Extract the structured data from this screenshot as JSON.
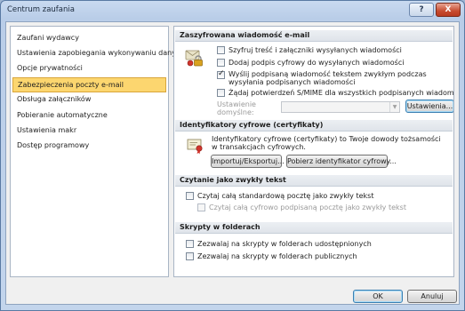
{
  "window": {
    "title": "Centrum zaufania",
    "help_glyph": "?",
    "close_glyph": "X"
  },
  "nav": {
    "items": [
      {
        "label": "Zaufani wydawcy"
      },
      {
        "label": "Ustawienia zapobiegania wykonywaniu danych"
      },
      {
        "label": "Opcje prywatności"
      },
      {
        "label": "Zabezpieczenia poczty e-mail",
        "selected": true
      },
      {
        "label": "Obsługa załączników"
      },
      {
        "label": "Pobieranie automatyczne"
      },
      {
        "label": "Ustawienia makr"
      },
      {
        "label": "Dostęp programowy"
      }
    ]
  },
  "encrypted": {
    "header": "Zaszyfrowana wiadomość e-mail",
    "icon": "lock-key-icon",
    "options": [
      {
        "label": "Szyfruj treść i załączniki wysyłanych wiadomości",
        "checked": false
      },
      {
        "label": "Dodaj podpis cyfrowy do wysyłanych wiadomości",
        "checked": false
      },
      {
        "label": "Wyślij podpisaną wiadomość tekstem zwykłym podczas wysyłania podpisanych wiadomości",
        "checked": true
      },
      {
        "label": "Żądaj potwierdzeń S/MIME dla wszystkich podpisanych wiadomości S/MIME",
        "checked": false
      }
    ],
    "default_setting_label": "Ustawienie domyślne:",
    "default_setting_value": "",
    "settings_button": "Ustawienia..."
  },
  "digital_ids": {
    "header": "Identyfikatory cyfrowe (certyfikaty)",
    "icon": "certificate-icon",
    "description": "Identyfikatory cyfrowe (certyfikaty) to Twoje dowody tożsamości w transakcjach cyfrowych.",
    "import_button": "Importuj/Eksportuj...",
    "get_id_button": "Pobierz identyfikator cyfrowy..."
  },
  "plain_text": {
    "header": "Czytanie jako zwykły tekst",
    "options": [
      {
        "label": "Czytaj całą standardową pocztę jako zwykły tekst",
        "checked": false,
        "disabled": false
      },
      {
        "label": "Czytaj całą cyfrowo podpisaną pocztę jako zwykły tekst",
        "checked": false,
        "disabled": true
      }
    ]
  },
  "scripts": {
    "header": "Skrypty w folderach",
    "options": [
      {
        "label": "Zezwalaj na skrypty w folderach udostępnionych",
        "checked": false
      },
      {
        "label": "Zezwalaj na skrypty w folderach publicznych",
        "checked": false
      }
    ]
  },
  "footer": {
    "ok": "OK",
    "cancel": "Anuluj"
  }
}
